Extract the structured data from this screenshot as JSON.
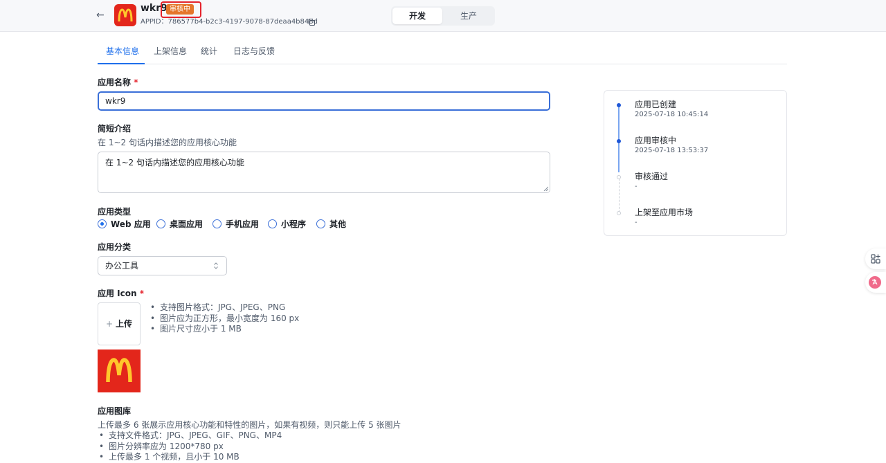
{
  "header": {
    "back_label": "←",
    "app_name": "wkr9",
    "status_badge": "审核中",
    "appid": "APPID：786577b4-b2c3-4197-9078-87deaa4b848d",
    "env": {
      "dev": "开发",
      "prod": "生产",
      "active": "开发"
    }
  },
  "tabs": [
    "基本信息",
    "上架信息",
    "统计",
    "日志与反馈"
  ],
  "form": {
    "app_name_label": "应用名称",
    "required_mark": "*",
    "app_name_value": "wkr9",
    "intro_label": "简短介绍",
    "intro_hint": "在 1~2 句话内描述您的应用核心功能",
    "intro_value": "在 1~2 句话内描述您的应用核心功能",
    "type_label": "应用类型",
    "types": [
      "Web 应用",
      "桌面应用",
      "手机应用",
      "小程序",
      "其他"
    ],
    "type_selected": "Web 应用",
    "category_label": "应用分类",
    "category_value": "办公工具",
    "icon_label": "应用 Icon",
    "upload_plus": "+",
    "upload_label": "上传",
    "icon_rules": [
      "支持图片格式：JPG、JPEG、PNG",
      "图片应为正方形，最小宽度为 160 px",
      "图片尺寸应小于 1 MB"
    ],
    "gallery_label": "应用图库",
    "gallery_hint": "上传最多 6 张展示应用核心功能和特性的图片，如果有视频，则只能上传 5 张图片",
    "gallery_rules": [
      "支持文件格式：JPG、JPEG、GIF、PNG、MP4",
      "图片分辨率应为 1200*780 px",
      "上传最多 1 个视频，且小于 10 MB"
    ]
  },
  "timeline": [
    {
      "title": "应用已创建",
      "time": "2025-07-18 10:45:14",
      "done": true
    },
    {
      "title": "应用审核中",
      "time": "2025-07-18 13:53:37",
      "done": true
    },
    {
      "title": "审核通过",
      "time": "-",
      "done": false
    },
    {
      "title": "上架至应用市场",
      "time": "-",
      "done": false
    }
  ],
  "colors": {
    "accent": "#1f6feb",
    "brand_red": "#e3261b",
    "badge": "#e5762b",
    "highlight": "#e5232c"
  }
}
